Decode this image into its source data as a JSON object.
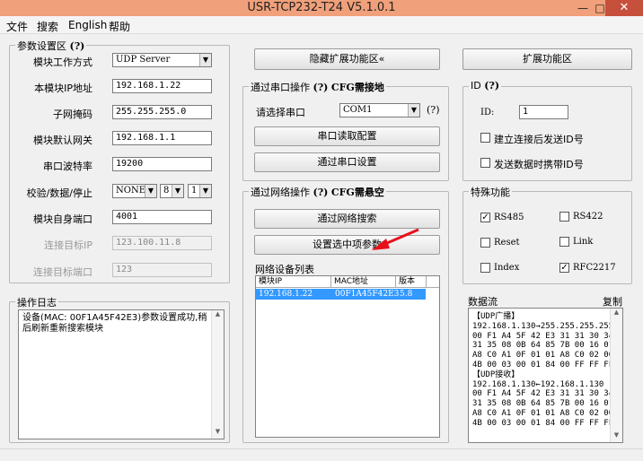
{
  "window": {
    "title": "USR-TCP232-T24 V5.1.0.1",
    "minimize": "—",
    "maximize": "□",
    "close": "✕"
  },
  "menu": [
    "文件",
    "搜索",
    "English",
    "帮助"
  ],
  "params": {
    "title": "参数设置区",
    "title_hint": "(?)",
    "mode_label": "模块工作方式",
    "mode_value": "UDP Server",
    "ip_label": "本模块IP地址",
    "ip_value": "192.168.1.22",
    "mask_label": "子网掩码",
    "mask_value": "255.255.255.0",
    "gateway_label": "模块默认网关",
    "gateway_value": "192.168.1.1",
    "baud_label": "串口波特率",
    "baud_value": "19200",
    "parity_label": "校验/数据/停止",
    "parity_value": "NONE",
    "data_bits_value": "8",
    "stop_bits_value": "1",
    "port_label": "模块自身端口",
    "port_value": "4001",
    "target_ip_label": "连接目标IP",
    "target_ip_value": "123.100.11.8",
    "target_port_label": "连接目标端口",
    "target_port_value": "123"
  },
  "log": {
    "title": "操作日志",
    "text": "设备(MAC: 00F1A45F42E3)参数设置成功,稍后刷新重新搜索模块"
  },
  "mid": {
    "hide_ext_button": "隐藏扩展功能区«",
    "serial_group_title": "通过串口操作",
    "serial_group_hint": "(?)",
    "serial_group_cfg": "CFG需接地",
    "select_port_label": "请选择串口",
    "port_select_value": "COM1",
    "port_hint": "(?)",
    "serial_read_button": "串口读取配置",
    "serial_set_button": "通过串口设置",
    "net_group_title": "通过网络操作",
    "net_group_hint": "(?)",
    "net_group_cfg": "CFG需悬空",
    "net_search_button": "通过网络搜索",
    "set_selected_button": "设置选中项参数",
    "device_list_label": "网络设备列表",
    "columns": [
      "模块IP",
      "MAC地址",
      "版本"
    ],
    "rows": [
      {
        "ip": "192.168.1.22",
        "mac": "00F1A45F42E3",
        "version": "5.8"
      }
    ]
  },
  "right": {
    "ext_button": "扩展功能区",
    "id_group_title": "ID",
    "id_group_hint": "(?)",
    "id_label": "ID:",
    "id_value": "1",
    "send_id_on_connect": "建立连接后发送ID号",
    "send_id_with_data": "发送数据时携带ID号",
    "special_title": "特殊功能",
    "rs485": "RS485",
    "rs422": "RS422",
    "reset": "Reset",
    "link": "Link",
    "index": "Index",
    "rfc2217": "RFC2217",
    "rs485_checked": true,
    "rs422_checked": false,
    "reset_checked": false,
    "link_checked": false,
    "index_checked": false,
    "rfc2217_checked": true,
    "stream_title": "数据流",
    "copy_label": "复制",
    "stream_text": "【UDP广播】\n192.168.1.130→255.255.255.255\n00 F1 A4 5F 42 E3 31 31 30 34\n31 35 08 0B 64 85 7B 00 16 01\nA8 C0 A1 0F 01 01 A8 C0 02 00\n4B 00 03 00 01 84 00 FF FF FF\n【UDP接收】\n192.168.1.130←192.168.1.130\n00 F1 A4 5F 42 E3 31 31 30 34\n31 35 08 0B 64 85 7B 00 16 01\nA8 C0 A1 0F 01 01 A8 C0 02 00\n4B 00 03 00 01 84 00 FF FF FF"
  },
  "icons": {
    "check": "✓",
    "dropdown": "▼",
    "scroll_up": "▲",
    "scroll_down": "▼"
  },
  "colors": {
    "titlebar": "#f0a07a",
    "close": "#c7503d",
    "selection": "#3399ff",
    "annotation_arrow": "#e8101a"
  }
}
